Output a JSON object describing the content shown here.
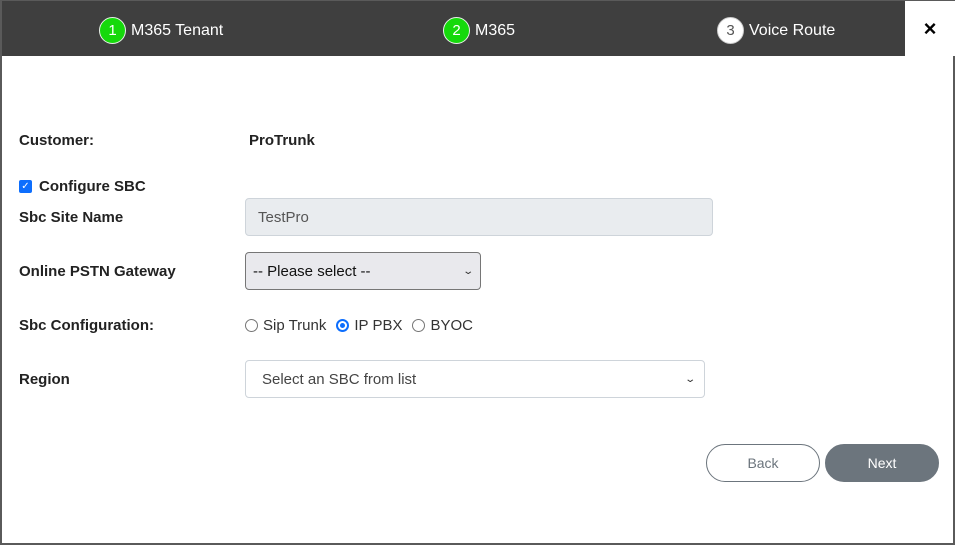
{
  "stepper": {
    "steps": [
      {
        "number": "1",
        "label": "M365 Tenant",
        "state": "done"
      },
      {
        "number": "2",
        "label": "M365",
        "state": "done"
      },
      {
        "number": "3",
        "label": "Voice Route",
        "state": "current"
      }
    ],
    "close_icon": "×",
    "colors": {
      "done": "#15d90b",
      "bar": "#3f3f3f"
    }
  },
  "form": {
    "customer_label": "Customer:",
    "customer_value": "ProTrunk",
    "configure_sbc": {
      "label": "Configure SBC",
      "checked": true,
      "check_glyph": "✓"
    },
    "sbc_site_name": {
      "label": "Sbc Site Name",
      "value": "TestPro"
    },
    "online_pstn_gateway": {
      "label": "Online PSTN Gateway",
      "selected": "-- Please select --",
      "chevron": "⌄"
    },
    "sbc_configuration": {
      "label": "Sbc Configuration:",
      "options": [
        {
          "label": "Sip Trunk",
          "checked": false
        },
        {
          "label": "IP PBX",
          "checked": true
        },
        {
          "label": "BYOC",
          "checked": false
        }
      ]
    },
    "region": {
      "label": "Region",
      "selected": "Select an SBC from list",
      "chevron": "⌄"
    }
  },
  "actions": {
    "back_label": "Back",
    "next_label": "Next"
  }
}
